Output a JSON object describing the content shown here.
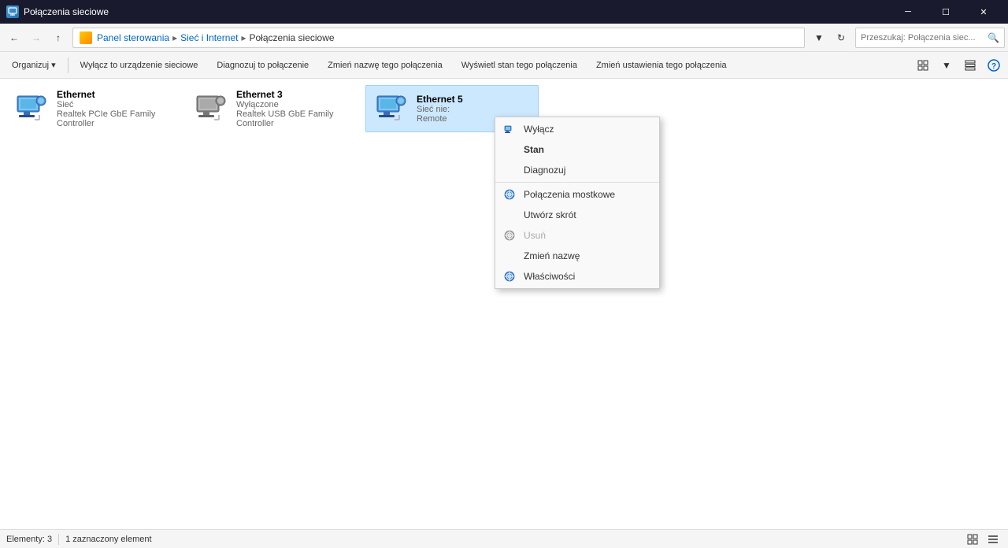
{
  "titleBar": {
    "icon": "🌐",
    "title": "Połączenia sieciowe",
    "minimizeLabel": "─",
    "maximizeLabel": "☐",
    "closeLabel": "✕"
  },
  "addressBar": {
    "backDisabled": false,
    "forwardDisabled": true,
    "upLabel": "↑",
    "breadcrumb": [
      {
        "label": "Panel sterowania",
        "isCurrent": false
      },
      {
        "label": "Sieć i Internet",
        "isCurrent": false
      },
      {
        "label": "Połączenia sieciowe",
        "isCurrent": true
      }
    ],
    "searchPlaceholder": "Przeszukaj: Połączenia siec...",
    "dropdownLabel": "▾",
    "refreshLabel": "↻"
  },
  "toolbar": {
    "organizeLabel": "Organizuj ▾",
    "disableLabel": "Wyłącz to urządzenie sieciowe",
    "diagnoseLabel": "Diagnozuj to połączenie",
    "renameLabel": "Zmień nazwę tego połączenia",
    "viewStatusLabel": "Wyświetl stan tego połączenia",
    "changeSettingsLabel": "Zmień ustawienia tego połączenia",
    "viewToggleLabel": "▦",
    "viewListLabel": "☰",
    "helpLabel": "?"
  },
  "networkItems": [
    {
      "name": "Ethernet",
      "status": "Sieć",
      "adapter": "Realtek PCIe GbE Family Controller",
      "selected": false
    },
    {
      "name": "Ethernet 3",
      "status": "Wyłączone",
      "adapter": "Realtek USB GbE Family Controller",
      "selected": false
    },
    {
      "name": "Ethernet 5",
      "status": "Sieć nie:",
      "adapter": "Remote",
      "selected": true
    }
  ],
  "contextMenu": {
    "items": [
      {
        "label": "Wyłącz",
        "hasIcon": true,
        "disabled": false,
        "bold": false,
        "separator": false
      },
      {
        "label": "Stan",
        "hasIcon": false,
        "disabled": false,
        "bold": true,
        "separator": false
      },
      {
        "label": "Diagnozuj",
        "hasIcon": false,
        "disabled": false,
        "bold": false,
        "separator": true
      },
      {
        "label": "Połączenia mostkowe",
        "hasIcon": true,
        "disabled": false,
        "bold": false,
        "separator": false
      },
      {
        "label": "Utwórz skrót",
        "hasIcon": false,
        "disabled": false,
        "bold": false,
        "separator": false
      },
      {
        "label": "Usuń",
        "hasIcon": true,
        "disabled": true,
        "bold": false,
        "separator": false
      },
      {
        "label": "Zmień nazwę",
        "hasIcon": false,
        "disabled": false,
        "bold": false,
        "separator": false
      },
      {
        "label": "Właściwości",
        "hasIcon": true,
        "disabled": false,
        "bold": false,
        "separator": false
      }
    ]
  },
  "statusBar": {
    "elementsText": "Elementy: 3",
    "selectedText": "1 zaznaczony element"
  }
}
